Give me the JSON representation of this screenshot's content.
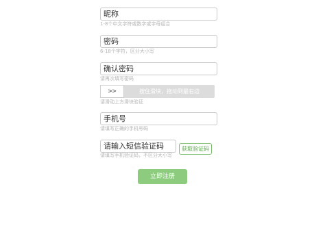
{
  "form": {
    "nickname": {
      "placeholder": "昵称",
      "hint": "1-8个中文字符或数字或字母组合"
    },
    "password": {
      "placeholder": "密码",
      "hint": "6-18个字符，区分大小写"
    },
    "confirm_password": {
      "placeholder": "确认密码",
      "hint": "请再次填写密码"
    },
    "slider_captcha": {
      "handle_label": ">>",
      "prompt": "按住滑块，拖动到最右边",
      "hint": "请滑动上方滑块验证"
    },
    "phone": {
      "placeholder": "手机号",
      "hint": "请填写正确的手机号码"
    },
    "sms_code": {
      "placeholder": "请输入短信验证码",
      "hint": "请填写手机验证码，不区分大小写",
      "button_label": "获取验证码"
    },
    "submit_label": "立即注册"
  },
  "colors": {
    "accent_green": "#8dcc7f",
    "accent_green_border": "#7cbf6f",
    "hint_gray": "#b3b3b3",
    "slider_track": "#dcdcdc"
  }
}
